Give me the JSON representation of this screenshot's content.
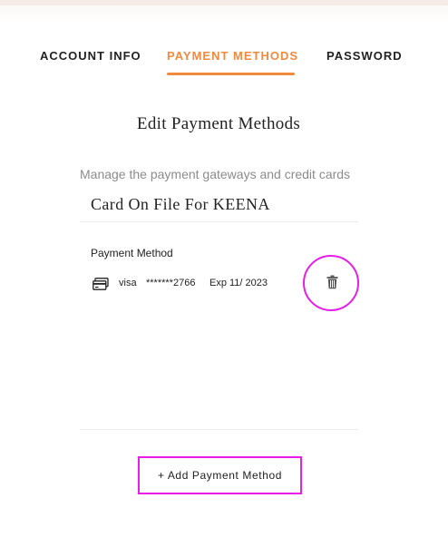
{
  "tabs": {
    "account_info": "ACCOUNT INFO",
    "payment_methods": "PAYMENT METHODS",
    "password": "PASSWORD",
    "active": "payment_methods"
  },
  "main": {
    "title": "Edit Payment Methods",
    "subtitle": "Manage the payment gateways and credit cards",
    "card_heading": "Card On File For KEENA",
    "payment_method_label": "Payment Method"
  },
  "card": {
    "brand": "visa",
    "number": "*******2766",
    "expiry": "Exp 11/ 2023",
    "icon": "credit-card-icon"
  },
  "actions": {
    "delete_icon": "trash-icon",
    "add_label": "+ Add Payment Method"
  },
  "colors": {
    "accent": "#ef8a3f",
    "highlight": "#e61ee6",
    "muted_text": "#8c8c8c",
    "text": "#222222"
  }
}
